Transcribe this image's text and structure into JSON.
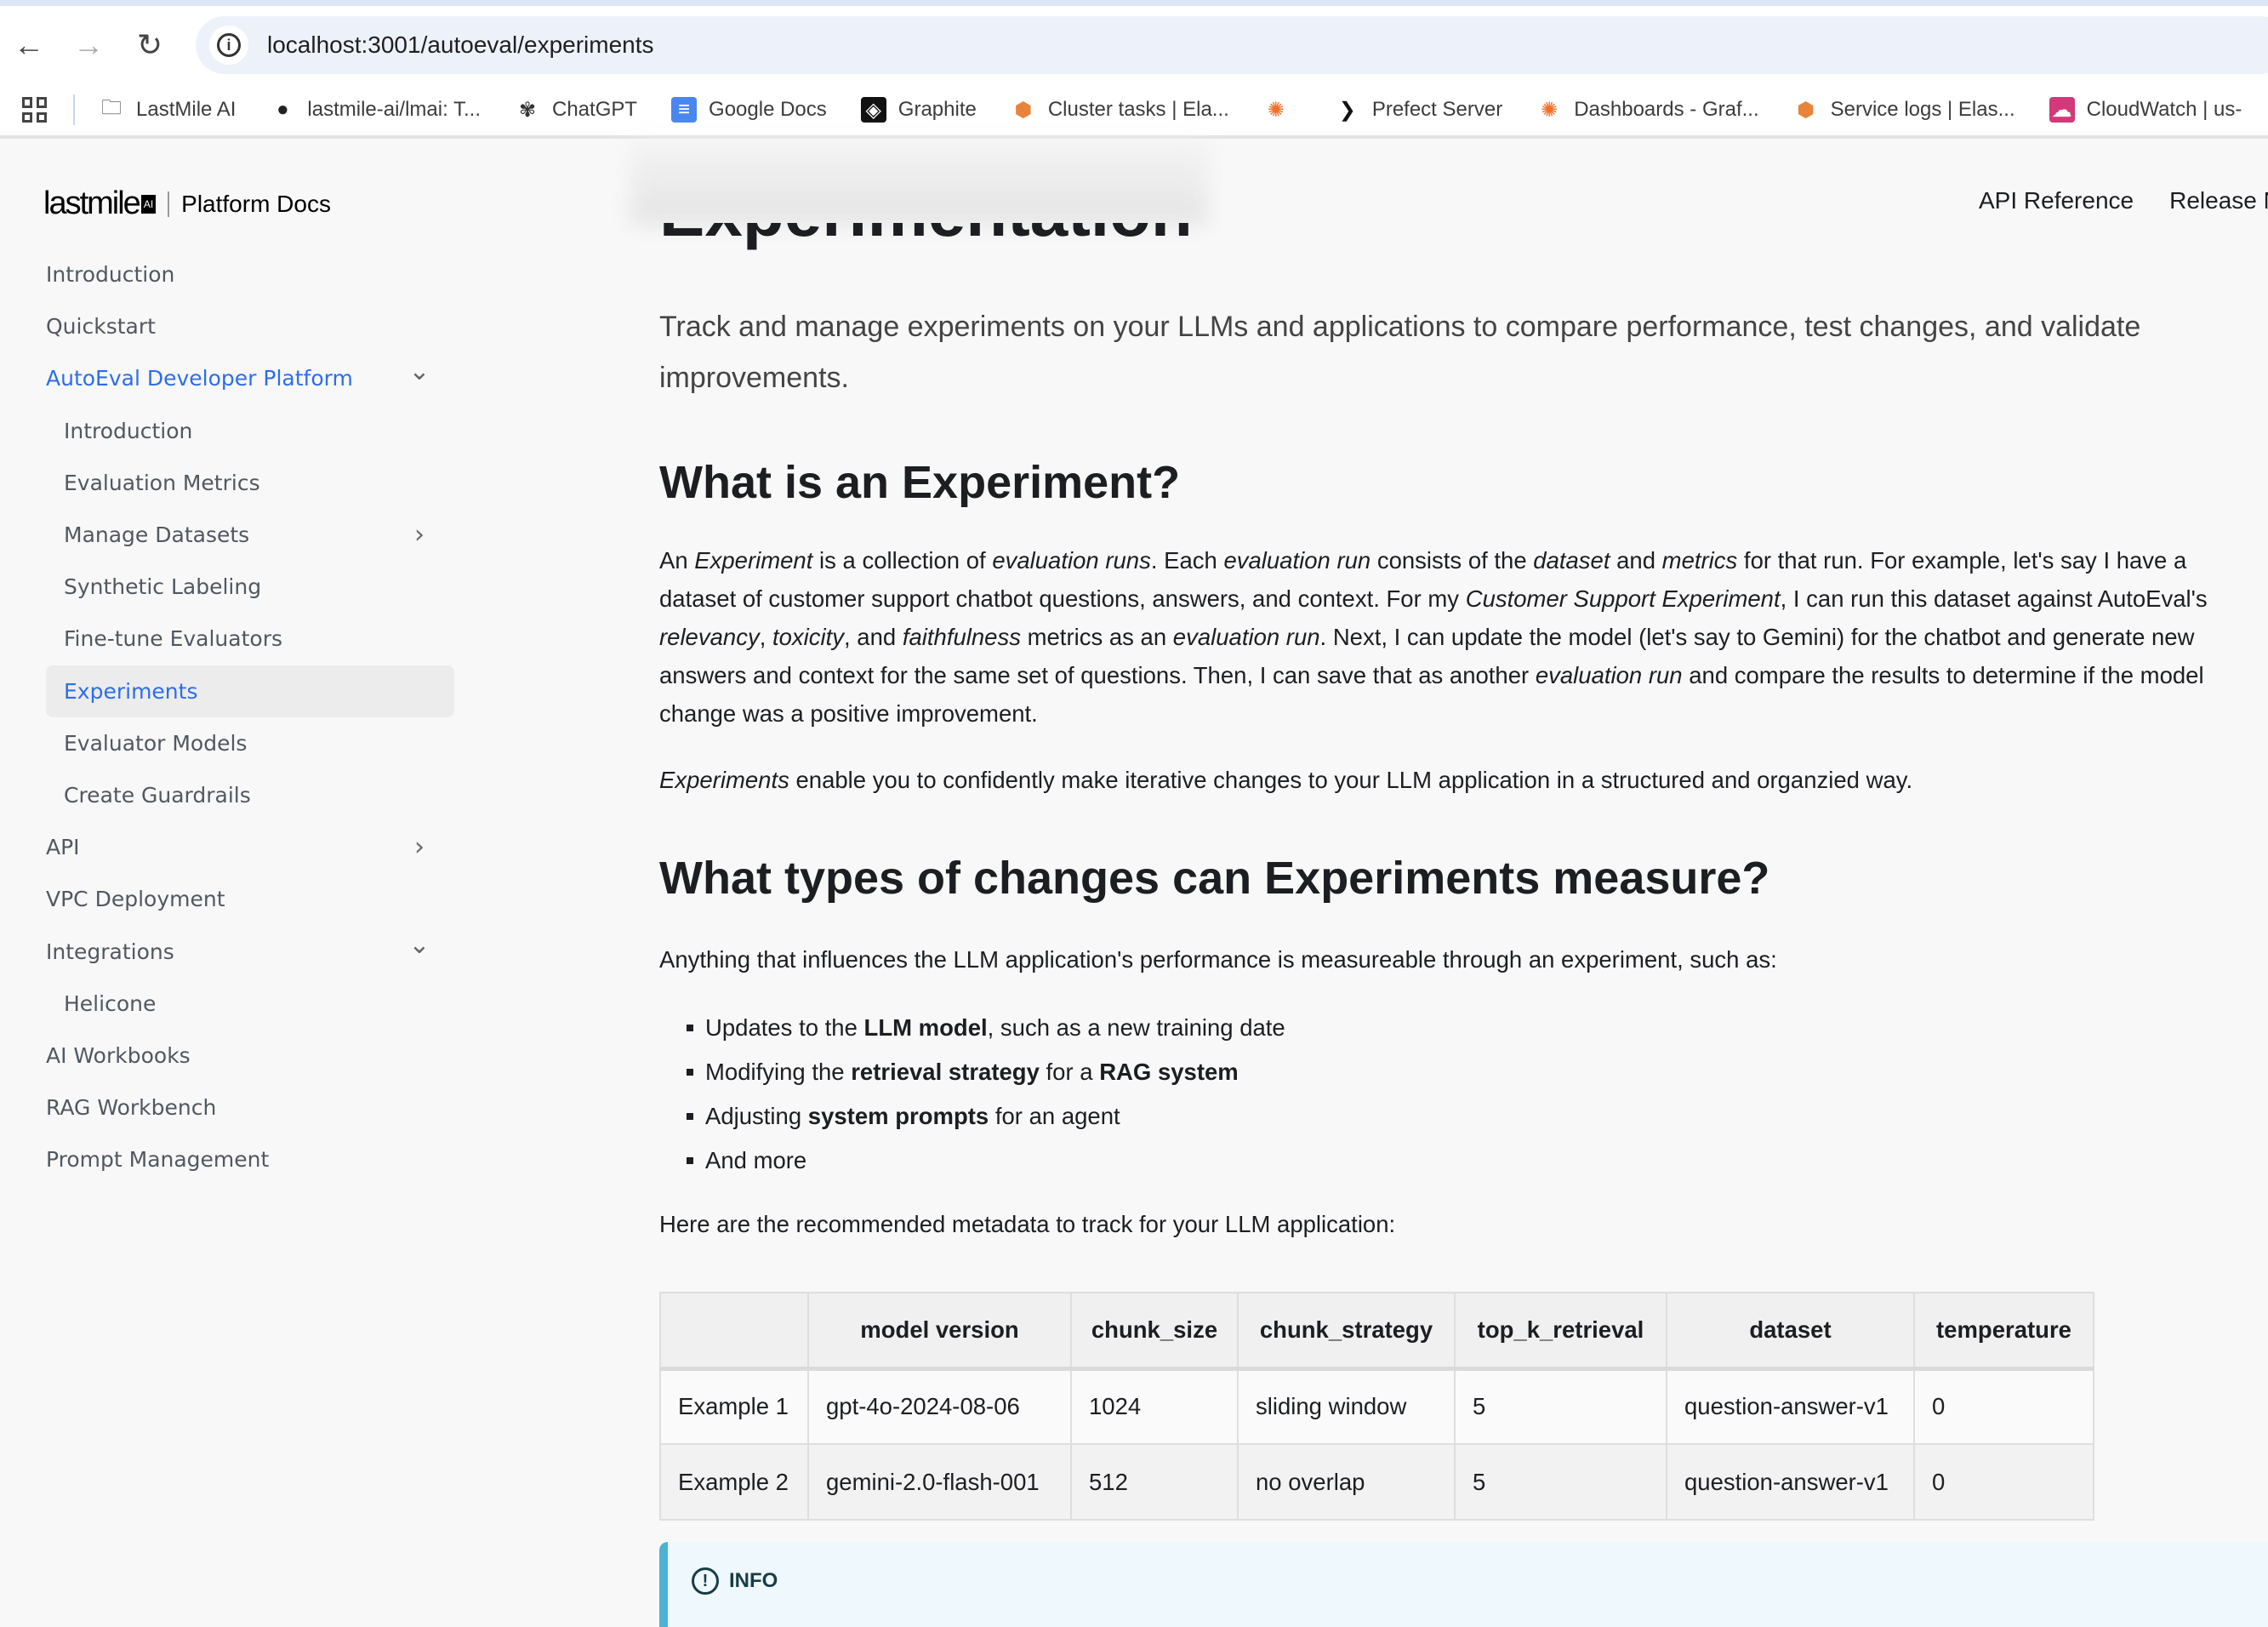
{
  "browser": {
    "url": "localhost:3001/autoeval/experiments",
    "bookmarks": [
      {
        "label": "LastMile AI",
        "icon": "folder-icon"
      },
      {
        "label": "lastmile-ai/lmai: T...",
        "icon": "github-icon"
      },
      {
        "label": "ChatGPT",
        "icon": "chatgpt-icon"
      },
      {
        "label": "Google Docs",
        "icon": "google-docs-icon"
      },
      {
        "label": "Graphite",
        "icon": "graphite-icon"
      },
      {
        "label": "Cluster tasks | Ela...",
        "icon": "elastic-icon"
      },
      {
        "label": "",
        "icon": "grafana-icon"
      },
      {
        "label": "Prefect Server",
        "icon": "prefect-icon"
      },
      {
        "label": "Dashboards - Graf...",
        "icon": "grafana-icon"
      },
      {
        "label": "Service logs | Elas...",
        "icon": "elastic-icon"
      },
      {
        "label": "CloudWatch | us-",
        "icon": "cloudwatch-icon"
      }
    ]
  },
  "header": {
    "logo": "lastmile",
    "logo_badge": "AI",
    "product": "Platform Docs",
    "nav": [
      "API Reference",
      "Release N"
    ]
  },
  "sidebar": {
    "items": [
      {
        "label": "Introduction",
        "level": 0
      },
      {
        "label": "Quickstart",
        "level": 0
      },
      {
        "label": "AutoEval Developer Platform",
        "level": 0,
        "active": true,
        "chevron": "down"
      },
      {
        "label": "Introduction",
        "level": 1
      },
      {
        "label": "Evaluation Metrics",
        "level": 1
      },
      {
        "label": "Manage Datasets",
        "level": 1,
        "chevron": "right"
      },
      {
        "label": "Synthetic Labeling",
        "level": 1
      },
      {
        "label": "Fine-tune Evaluators",
        "level": 1
      },
      {
        "label": "Experiments",
        "level": 1,
        "active": true,
        "selected": true
      },
      {
        "label": "Evaluator Models",
        "level": 1
      },
      {
        "label": "Create Guardrails",
        "level": 1
      },
      {
        "label": "API",
        "level": 0,
        "chevron": "right"
      },
      {
        "label": "VPC Deployment",
        "level": 0
      },
      {
        "label": "Integrations",
        "level": 0,
        "chevron": "down"
      },
      {
        "label": "Helicone",
        "level": 1
      },
      {
        "label": "AI Workbooks",
        "level": 0
      },
      {
        "label": "RAG Workbench",
        "level": 0
      },
      {
        "label": "Prompt Management",
        "level": 0
      }
    ]
  },
  "content": {
    "title": "Experimentation",
    "lead": "Track and manage experiments on your LLMs and applications to compare performance, test changes, and validate improvements.",
    "h2_1": "What is an Experiment?",
    "p1": [
      {
        "t": "An "
      },
      {
        "t": "Experiment",
        "s": "i"
      },
      {
        "t": " is a collection of "
      },
      {
        "t": "evaluation runs",
        "s": "i"
      },
      {
        "t": ". Each "
      },
      {
        "t": "evaluation run",
        "s": "i"
      },
      {
        "t": " consists of the "
      },
      {
        "t": "dataset",
        "s": "i"
      },
      {
        "t": " and "
      },
      {
        "t": "metrics",
        "s": "i"
      },
      {
        "t": " for that run. For example, let's say I have a dataset of customer support chatbot questions, answers, and context. For my "
      },
      {
        "t": "Customer Support Experiment",
        "s": "i"
      },
      {
        "t": ", I can run this dataset against AutoEval's "
      },
      {
        "t": "relevancy",
        "s": "i"
      },
      {
        "t": ", "
      },
      {
        "t": "toxicity",
        "s": "i"
      },
      {
        "t": ", and "
      },
      {
        "t": "faithfulness",
        "s": "i"
      },
      {
        "t": " metrics as an "
      },
      {
        "t": "evaluation run",
        "s": "i"
      },
      {
        "t": ". Next, I can update the model (let's say to Gemini) for the chatbot and generate new answers and context for the same set of questions. Then, I can save that as another "
      },
      {
        "t": "evaluation run",
        "s": "i"
      },
      {
        "t": " and compare the results to determine if the model change was a positive improvement."
      }
    ],
    "p2": [
      {
        "t": "Experiments",
        "s": "i"
      },
      {
        "t": " enable you to confidently make iterative changes to your LLM application in a structured and organzied way."
      }
    ],
    "h2_2": "What types of changes can Experiments measure?",
    "p3": "Anything that influences the LLM application's performance is measureable through an experiment, such as:",
    "bullets": [
      [
        {
          "t": "Updates to the "
        },
        {
          "t": "LLM model",
          "s": "b"
        },
        {
          "t": ", such as a new training date"
        }
      ],
      [
        {
          "t": "Modifying the "
        },
        {
          "t": "retrieval strategy",
          "s": "b"
        },
        {
          "t": " for a "
        },
        {
          "t": "RAG system",
          "s": "b"
        }
      ],
      [
        {
          "t": "Adjusting "
        },
        {
          "t": "system prompts",
          "s": "b"
        },
        {
          "t": " for an agent"
        }
      ],
      [
        {
          "t": "And more"
        }
      ]
    ],
    "p4": "Here are the recommended metadata to track for your LLM application:",
    "table": {
      "headers": [
        "",
        "model version",
        "chunk_size",
        "chunk_strategy",
        "top_k_retrieval",
        "dataset",
        "temperature"
      ],
      "rows": [
        [
          "Example 1",
          "gpt-4o-2024-08-06",
          "1024",
          "sliding window",
          "5",
          "question-answer-v1",
          "0"
        ],
        [
          "Example 2",
          "gemini-2.0-flash-001",
          "512",
          "no overlap",
          "5",
          "question-answer-v1",
          "0"
        ]
      ]
    },
    "info_label": "INFO"
  },
  "colors": {
    "accent": "#2d6ee8",
    "info_border": "#4cb3d4",
    "info_bg": "#eef8fd"
  }
}
